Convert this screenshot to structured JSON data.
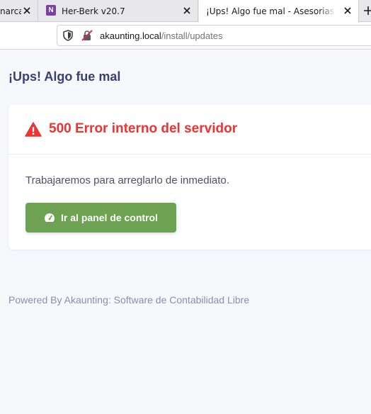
{
  "browser": {
    "tabs": [
      {
        "label": "narca"
      },
      {
        "label": "Her-Berk v20.7",
        "icon_letter": "N"
      },
      {
        "label": "¡Ups! Algo fue mal - Asesorias ASA"
      }
    ],
    "address_host": "akaunting.local",
    "address_path": "/install/updates"
  },
  "page": {
    "title": "¡Ups! Algo fue mal",
    "error_title": "500 Error interno del servidor",
    "message": "Trabajaremos para arreglarlo de inmediato.",
    "dashboard_button": "Ir al panel de control",
    "footer": "Powered By Akaunting: Software de Contabilidad Libre"
  },
  "colors": {
    "error": "#ef3232",
    "button": "#6da252",
    "title": "#3c3f72"
  }
}
